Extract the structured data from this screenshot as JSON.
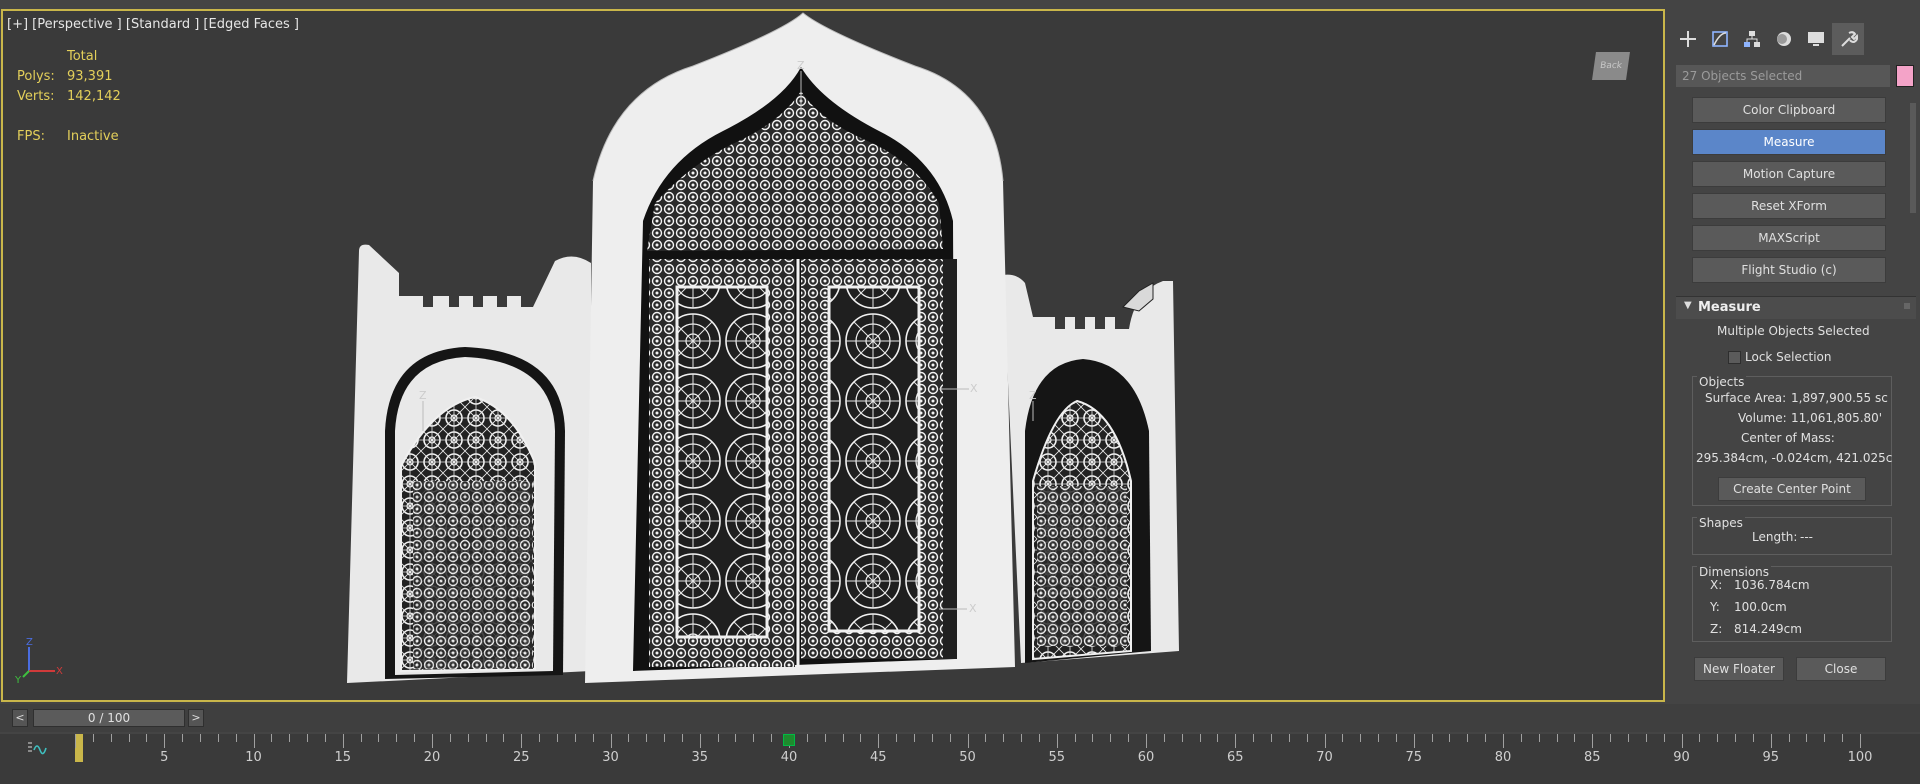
{
  "viewport": {
    "label": "[+] [Perspective ] [Standard ] [Edged Faces ]",
    "stats": {
      "header": "Total",
      "polys_label": "Polys:",
      "polys_value": "93,391",
      "verts_label": "Verts:",
      "verts_value": "142,142",
      "fps_label": "FPS:",
      "fps_value": "Inactive"
    },
    "viewcube_label": "Back",
    "gizmo_labels": [
      "X",
      "Y",
      "Z"
    ]
  },
  "command_panel": {
    "tabs": [
      "create-icon",
      "modify-icon",
      "hierarchy-icon",
      "motion-icon",
      "display-icon",
      "utilities-icon"
    ],
    "selection_field": "27 Objects Selected",
    "swatch_color": "#f4a3c8",
    "utility_buttons": [
      "Color Clipboard",
      "Measure",
      "Motion Capture",
      "Reset XForm",
      "MAXScript",
      "Flight Studio (c)"
    ],
    "active_button": "Measure",
    "measure": {
      "title": "Measure",
      "status": "Multiple Objects Selected",
      "lock_selection": "Lock Selection",
      "objects": {
        "title": "Objects",
        "surface_area_label": "Surface Area:",
        "surface_area": "1,897,900.55 sc",
        "volume_label": "Volume:",
        "volume": "11,061,805.80'",
        "center_label": "Center of Mass:",
        "center": "295.384cm, -0.024cm, 421.025c",
        "create_center_button": "Create Center Point"
      },
      "shapes": {
        "title": "Shapes",
        "length_label": "Length:",
        "length": "---"
      },
      "dimensions": {
        "title": "Dimensions",
        "x_label": "X:",
        "x": "1036.784cm",
        "y_label": "Y:",
        "y": "100.0cm",
        "z_label": "Z:",
        "z": "814.249cm"
      },
      "new_floater_button": "New Floater",
      "close_button": "Close"
    }
  },
  "timeline": {
    "prev": "<",
    "frame_display": "0 / 100",
    "next": ">",
    "tick_labels": [
      "5",
      "10",
      "15",
      "20",
      "25",
      "30",
      "35",
      "40",
      "45",
      "50",
      "55",
      "60",
      "65",
      "70",
      "75",
      "80",
      "85",
      "90",
      "95",
      "100"
    ],
    "key_frame": 40,
    "range_end": 100
  }
}
